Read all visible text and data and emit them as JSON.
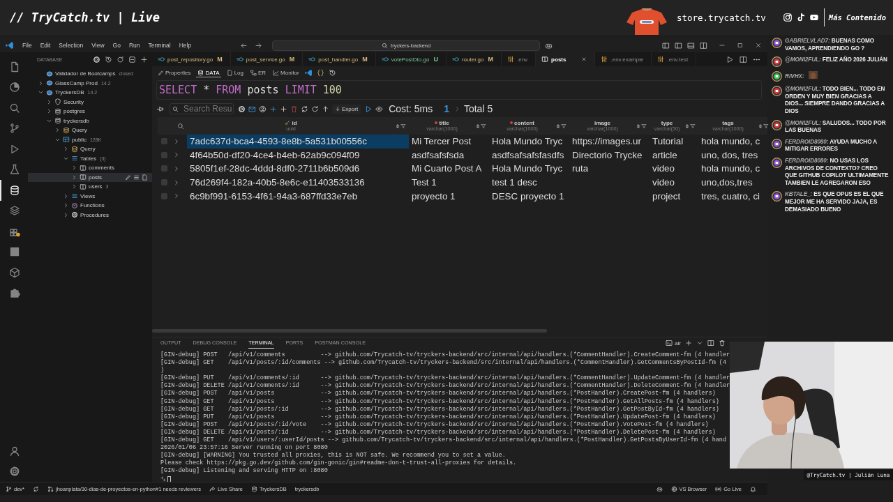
{
  "stream_header": {
    "title": "// TryCatch.tv | Live",
    "store": "store.trycatch.tv",
    "more": "Más Contenido"
  },
  "window": {
    "menu": [
      "File",
      "Edit",
      "Selection",
      "View",
      "Go",
      "Run",
      "Terminal",
      "Help"
    ],
    "search": "tryckers-backend"
  },
  "activity_bar": [
    {
      "selected": false
    },
    {
      "selected": false
    },
    {
      "selected": false
    },
    {
      "selected": false
    },
    {
      "selected": false
    },
    {
      "selected": false
    },
    {
      "selected": true
    },
    {
      "selected": false
    },
    {
      "selected": false
    },
    {
      "selected": false
    },
    {
      "selected": false
    },
    {
      "selected": false
    }
  ],
  "sidebar": {
    "title": "DATABASE",
    "tree": [
      {
        "label": "Validador de Bootcamps",
        "note": "closed",
        "kind": "connection",
        "selected": false
      },
      {
        "label": "GlassCamp Prod",
        "note": "14.2",
        "kind": "connection",
        "expanded": false,
        "selected": false
      },
      {
        "label": "TryckersDB",
        "note": "14.2",
        "kind": "connection",
        "expanded": true,
        "selected": false,
        "children": [
          {
            "label": "Security",
            "kind": "security",
            "expanded": false,
            "selected": false
          },
          {
            "label": "postgres",
            "kind": "database",
            "expanded": false,
            "selected": false
          },
          {
            "label": "tryckersdb",
            "kind": "database",
            "expanded": true,
            "selected": false,
            "children": [
              {
                "label": "Query",
                "kind": "query",
                "expanded": false,
                "selected": false
              },
              {
                "label": "public",
                "note": "128K",
                "kind": "schema",
                "expanded": true,
                "selected": false,
                "children": [
                  {
                    "label": "Query",
                    "kind": "query",
                    "expanded": false,
                    "selected": false
                  },
                  {
                    "label": "Tables",
                    "note": "(3)",
                    "kind": "list",
                    "expanded": true,
                    "selected": false,
                    "children": [
                      {
                        "label": "comments",
                        "kind": "table",
                        "expanded": false,
                        "selected": false
                      },
                      {
                        "label": "posts",
                        "kind": "table",
                        "expanded": false,
                        "selected": true
                      },
                      {
                        "label": "users",
                        "note": "3",
                        "kind": "table",
                        "expanded": false,
                        "selected": false
                      }
                    ]
                  },
                  {
                    "label": "Views",
                    "kind": "list",
                    "expanded": false,
                    "selected": false
                  },
                  {
                    "label": "Functions",
                    "kind": "function",
                    "expanded": false,
                    "selected": false
                  },
                  {
                    "label": "Procedures",
                    "kind": "procedure",
                    "expanded": false,
                    "selected": false
                  }
                ]
              }
            ]
          }
        ]
      }
    ]
  },
  "editor_tabs": [
    {
      "label": "post_repository.go",
      "badge": "M",
      "kind": "go",
      "color": "#d7ba7d",
      "dimmed": false,
      "selected": false
    },
    {
      "label": "post_service.go",
      "badge": "M",
      "kind": "go",
      "color": "#d7ba7d",
      "dimmed": false,
      "selected": false
    },
    {
      "label": "post_handler.go",
      "badge": "M",
      "kind": "go",
      "color": "#d7ba7d",
      "dimmed": false,
      "selected": false
    },
    {
      "label": "votePostDto.go",
      "badge": "U",
      "kind": "go",
      "color": "#73c991",
      "dimmed": false,
      "selected": false
    },
    {
      "label": "router.go",
      "badge": "M",
      "kind": "go",
      "color": "#d7ba7d",
      "dimmed": false,
      "selected": false
    },
    {
      "label": ".env",
      "kind": "env",
      "dimmed": true,
      "selected": false
    },
    {
      "label": "posts",
      "kind": "table",
      "dimmed": false,
      "selected": true
    },
    {
      "label": ".env.example",
      "kind": "env",
      "dimmed": true,
      "selected": false
    },
    {
      "label": ".env.test",
      "kind": "env",
      "dimmed": true,
      "selected": false
    }
  ],
  "db_tabs": [
    {
      "label": "Properties",
      "kind": "properties",
      "selected": false
    },
    {
      "label": "DATA",
      "kind": "data",
      "selected": true
    },
    {
      "label": "Log",
      "kind": "log",
      "selected": false
    },
    {
      "label": "ER",
      "kind": "er",
      "selected": false
    },
    {
      "label": "Monitor",
      "kind": "monitor",
      "selected": false
    }
  ],
  "query": [
    {
      "text": "SELECT",
      "kind": "keyword"
    },
    {
      "text": " * ",
      "kind": "plain"
    },
    {
      "text": "FROM",
      "kind": "keyword"
    },
    {
      "text": " posts ",
      "kind": "plain"
    },
    {
      "text": "LIMIT",
      "kind": "keyword"
    },
    {
      "text": " 100",
      "kind": "number"
    }
  ],
  "results_toolbar": {
    "search_placeholder": "Search Resu",
    "export": "Export",
    "cost": "Cost: 5ms",
    "page": "1",
    "total": "Total 5"
  },
  "table": {
    "columns": [
      {
        "name": "id",
        "type": "uuid",
        "primary_key": true,
        "required": false
      },
      {
        "name": "title",
        "type": "varchar(1000)",
        "primary_key": false,
        "required": true
      },
      {
        "name": "content",
        "type": "varchar(1000)",
        "primary_key": false,
        "required": true
      },
      {
        "name": "image",
        "type": "varchar(1000)",
        "primary_key": false,
        "required": false
      },
      {
        "name": "type",
        "type": "varchar(50)",
        "primary_key": false,
        "required": false
      },
      {
        "name": "tags",
        "type": "varchar(1000)",
        "primary_key": false,
        "required": false
      }
    ],
    "rows": [
      {
        "selected": true,
        "checked": false,
        "cells": [
          "7adc637d-bca4-4593-8e8b-5a531b00556c",
          "Mi Tercer Post",
          "Hola Mundo Tryc",
          "https://images.ur",
          "Tutorial",
          "hola mundo, c"
        ]
      },
      {
        "selected": false,
        "checked": false,
        "cells": [
          "4f64b50d-df20-4ce4-b4eb-62ab9c094f09",
          "asdfsafsfsda",
          "asdfsafsafsfasdfs",
          "Directorio Trycke",
          "article",
          "uno, dos, tres"
        ]
      },
      {
        "selected": false,
        "checked": false,
        "cells": [
          "5805f1ef-28dc-4ddd-8df0-2711b6b509d6",
          "Mi Cuarto Post A",
          "Hola Mundo Tryc",
          "ruta",
          "video",
          "hola mundo, c"
        ]
      },
      {
        "selected": false,
        "checked": false,
        "cells": [
          "76d269f4-182a-40b5-8e6c-e11403533136",
          "Test 1",
          "test 1 desc",
          "",
          "video",
          "uno,dos,tres"
        ]
      },
      {
        "selected": false,
        "checked": false,
        "cells": [
          "6c9bf991-6153-4f61-94a3-687ffd33e7eb",
          "proyecto 1",
          "DESC proyecto 1",
          "",
          "project",
          "tres, cuatro, ci"
        ]
      }
    ]
  },
  "panel": {
    "tabs": [
      {
        "label": "OUTPUT",
        "selected": false
      },
      {
        "label": "DEBUG CONSOLE",
        "selected": false
      },
      {
        "label": "TERMINAL",
        "selected": true
      },
      {
        "label": "PORTS",
        "selected": false
      },
      {
        "label": "POSTMAN CONSOLE",
        "selected": false
      }
    ],
    "terminal_name": "air",
    "lines": [
      "[GIN-debug] POST   /api/v1/comments          --> github.com/Trycatch-tv/tryckers-backend/src/internal/api/handlers.(*CommentHandler).CreateComment-fm (4 handler",
      "[GIN-debug] GET    /api/v1/posts/:id/comments --> github.com/Trycatch-tv/tryckers-backend/src/internal/api/handlers.(*CommentHandler).GetCommentsByPostId-fm (4",
      ")",
      "[GIN-debug] PUT    /api/v1/comments/:id      --> github.com/Trycatch-tv/tryckers-backend/src/internal/api/handlers.(*CommentHandler).UpdateComment-fm (4 handler",
      "[GIN-debug] DELETE /api/v1/comments/:id      --> github.com/Trycatch-tv/tryckers-backend/src/internal/api/handlers.(*CommentHandler).DeleteComment-fm (4 handler",
      "[GIN-debug] POST   /api/v1/posts             --> github.com/Trycatch-tv/tryckers-backend/src/internal/api/handlers.(*PostHandler).CreatePost-fm (4 handlers)",
      "[GIN-debug] GET    /api/v1/posts             --> github.com/Trycatch-tv/tryckers-backend/src/internal/api/handlers.(*PostHandler).GetAllPosts-fm (4 handlers)",
      "[GIN-debug] GET    /api/v1/posts/:id         --> github.com/Trycatch-tv/tryckers-backend/src/internal/api/handlers.(*PostHandler).GetPostById-fm (4 handlers)",
      "[GIN-debug] PUT    /api/v1/posts             --> github.com/Trycatch-tv/tryckers-backend/src/internal/api/handlers.(*PostHandler).UpdatePost-fm (4 handlers)",
      "[GIN-debug] POST   /api/v1/posts/:id/vote    --> github.com/Trycatch-tv/tryckers-backend/src/internal/api/handlers.(*PostHandler).VotePost-fm (4 handlers)",
      "[GIN-debug] DELETE /api/v1/posts/:id         --> github.com/Trycatch-tv/tryckers-backend/src/internal/api/handlers.(*PostHandler).DeletePost-fm (4 handlers)",
      "[GIN-debug] GET    /api/v1/users/:userId/posts --> github.com/Trycatch-tv/tryckers-backend/src/internal/api/handlers.(*PostHandler).GetPostsByUserId-fm (4 hand",
      "2026/01/06 23:57:16 Server running on port 8080",
      "[GIN-debug] [WARNING] You trusted all proxies, this is NOT safe. We recommend you to set a value.",
      "Please check https://pkg.go.dev/github.com/gin-gonic/gin#readme-don-t-trust-all-proxies for details.",
      "[GIN-debug] Listening and serving HTTP on :8080"
    ]
  },
  "status_bar": {
    "left": [
      {
        "kind": "branch",
        "label": "dev*"
      },
      {
        "kind": "sync"
      },
      {
        "kind": "pull-request",
        "label": "jhoanplata/30-dias-de-proyectos-en-python#1 needs reviewers"
      },
      {
        "kind": "live-share",
        "label": "Live Share"
      },
      {
        "kind": "database",
        "label": "TryckersDB"
      },
      {
        "kind": "plain",
        "label": "tryckersdb"
      }
    ],
    "right": [
      {
        "kind": "copilot"
      },
      {
        "kind": "globe",
        "label": "VS Browser"
      },
      {
        "kind": "broadcast",
        "label": "Go Live"
      },
      {
        "kind": "bell"
      }
    ]
  },
  "chat": [
    {
      "color": "#8e5ad8",
      "kind": "text",
      "text": "*GABRIELVLAD7:* BUENAS COMO VAMOS, APRENDIENDO GO ?"
    },
    {
      "color": "#d83a3a",
      "kind": "text",
      "text": "*@MONI2FUL:* FELIZ AÑO 2026 JULIÁN"
    },
    {
      "color": "#35d04a",
      "kind": "emote",
      "text": "RIVHX:"
    },
    {
      "color": "#d83a3a",
      "kind": "text",
      "text": "*@MONI2FUL:* TODO BIEN... TODO EN ORDEN Y MUY BIEN GRACIAS A DIOS... SIEMPRE DANDO GRACIAS A DIOS"
    },
    {
      "color": "#d83a3a",
      "kind": "text",
      "text": "*@MONI2FUL:* SALUDOS... TODO POR LAS BUENAS"
    },
    {
      "color": "#8e5ad8",
      "kind": "text",
      "text": "*FERDROID8080:* AYUDA MUCHO A MITIGAR ERRORES"
    },
    {
      "color": "#8e5ad8",
      "kind": "text",
      "text": "*FERDROID8080:* NO USAS LOS ARCHIVOS DE CONTEXTO? CREO QUE GITHUB COPILOT ULTIMAMENTE TAMBIEN LE AGREGARON ESO"
    },
    {
      "color": "#8e5ad8",
      "kind": "text",
      "text": "*KBTALE_:* ES QUE OPUS ES EL QUE MEJOR ME HA SERVIDO JAJA, ES DEMASIADO BUENO"
    }
  ],
  "webcam": {
    "kind": "picture",
    "caption": "@TryCatch.tv | Julián Luna"
  }
}
